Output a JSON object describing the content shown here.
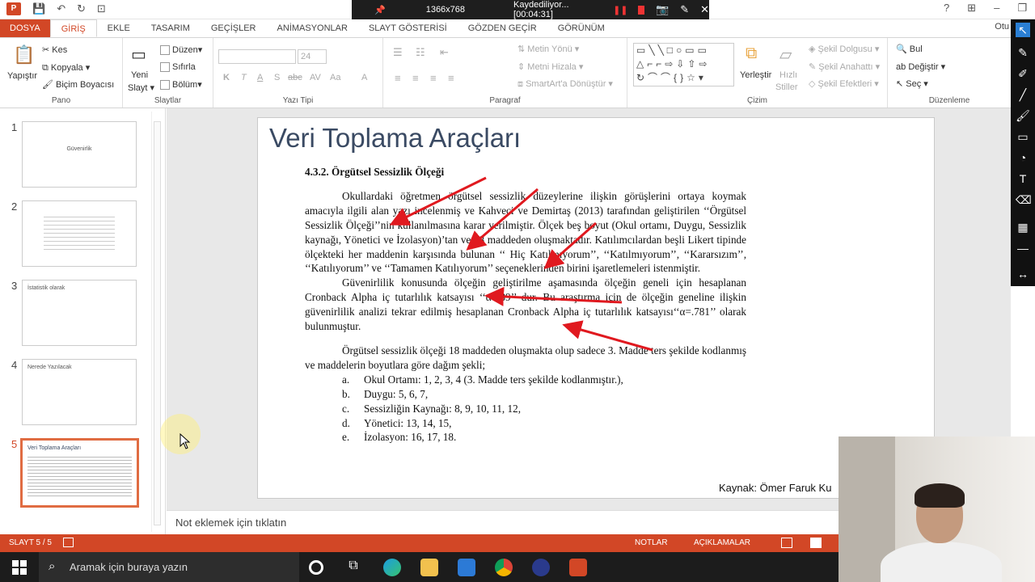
{
  "recorder": {
    "resolution": "1366x768",
    "status": "Kaydediliyor... [00:04:31]"
  },
  "menu": {
    "file": "DOSYA",
    "tabs": [
      "GİRİŞ",
      "EKLE",
      "TASARIM",
      "GEÇİŞLER",
      "ANİMASYONLAR",
      "SLAYT GÖSTERİSİ",
      "GÖZDEN GEÇİR",
      "GÖRÜNÜM"
    ],
    "user": "Otu"
  },
  "ribbon": {
    "pano": {
      "label": "Pano",
      "paste": "Yapıştır",
      "cut": "Kes",
      "copy": "Kopyala",
      "format_painter": "Biçim Boyacısı"
    },
    "slaytlar": {
      "label": "Slaytlar",
      "new_slide_1": "Yeni",
      "new_slide_2": "Slayt",
      "layout": "Düzen",
      "reset": "Sıfırla",
      "section": "Bölüm"
    },
    "font": {
      "label": "Yazı Tipi",
      "size": "24",
      "buttons": [
        "K",
        "T",
        "A",
        "S",
        "abc",
        "AV",
        "Aa",
        "A"
      ]
    },
    "paragraph": {
      "label": "Paragraf",
      "text_direction": "Metin Yönü",
      "align_text": "Metni Hizala",
      "smartart": "SmartArt'a Dönüştür"
    },
    "drawing": {
      "label": "Çizim",
      "arrange": "Yerleştir",
      "quick_styles_1": "Hızlı",
      "quick_styles_2": "Stiller",
      "shape_fill": "Şekil Dolgusu",
      "shape_outline": "Şekil Anahattı",
      "shape_effects": "Şekil Efektleri"
    },
    "editing": {
      "label": "Düzenleme",
      "find": "Bul",
      "replace": "Değiştir",
      "select": "Seç"
    }
  },
  "thumbnails": [
    {
      "num": "1",
      "text": "Güvenirlik"
    },
    {
      "num": "2",
      "text": ""
    },
    {
      "num": "3",
      "text": "İstatistik olarak"
    },
    {
      "num": "4",
      "text": "Nerede Yazılacak"
    },
    {
      "num": "5",
      "text": "Veri Toplama Araçları"
    }
  ],
  "slide": {
    "title": "Veri Toplama Araçları",
    "heading": "4.3.2. Örgütsel Sessizlik Ölçeği",
    "p1": "Okullardaki öğretmen örgütsel sessizlik düzeylerine ilişkin görüşlerini ortaya koymak amacıyla ilgili alan yazı incelenmiş ve Kahveci ve Demirtaş (2013) tarafından geliştirilen ‘‘Örgütsel Sessizlik Ölçeği’’nin kullanılmasına karar verilmiştir. Ölçek beş boyut (Okul ortamı, Duygu, Sessizlik kaynağı, Yönetici ve İzolasyon)’tan ve 18 maddeden oluşmaktadır. Katılımcılardan beşli Likert tipinde ölçekteki her maddenin karşısında bulunan ‘‘ Hiç Katılmıyorum’’, ‘‘Katılmıyorum’’, ‘‘Kararsızım’’, ‘‘Katılıyorum’’ ve ‘‘Tamamen Katılıyorum’’ seçeneklerinden birini işaretlemeleri istenmiştir.",
    "p2": "Güvenirlilik konusunda ölçeğin geliştirilme aşamasında ölçeğin geneli için hesaplanan Cronback Alpha iç tutarlılık katsayısı ‘‘α=.89’’ dur. Bu araştırma için de ölçeğin geneline ilişkin güvenirlilik analizi tekrar edilmiş hesaplanan Cronback Alpha iç tutarlılık katsayısı‘‘α=.781’’ olarak bulunmuştur.",
    "p3": "Örgütsel sessizlik ölçeği 18 maddeden oluşmakta olup sadece 3. Madde ters şekilde kodlanmış ve maddelerin boyutlara göre dağım şekli;",
    "items": [
      {
        "letter": "a.",
        "text": "Okul Ortamı: 1, 2, 3, 4 (3. Madde ters şekilde kodlanmıştır.),"
      },
      {
        "letter": "b.",
        "text": "Duygu: 5, 6, 7,"
      },
      {
        "letter": "c.",
        "text": "Sessizliğin Kaynağı: 8, 9, 10, 11, 12,"
      },
      {
        "letter": "d.",
        "text": "Yönetici: 13, 14, 15,"
      },
      {
        "letter": "e.",
        "text": "İzolasyon: 16, 17, 18."
      }
    ],
    "source": "Kaynak: Ömer Faruk Ku"
  },
  "notes_placeholder": "Not eklemek için tıklatın",
  "status": {
    "slide": "SLAYT 5 / 5",
    "notes": "NOTLAR",
    "comments": "AÇIKLAMALAR"
  },
  "taskbar": {
    "search": "Aramak için buraya yazın"
  }
}
